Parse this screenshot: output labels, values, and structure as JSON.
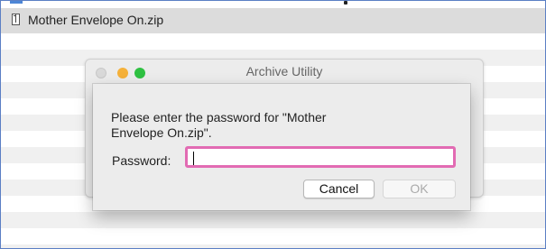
{
  "file_list": {
    "file_name": "Mother Envelope On.zip",
    "file_icon": "zip-file-icon"
  },
  "background_window": {
    "title": "Archive Utility",
    "buttons": [
      "close-button",
      "minimize-button",
      "zoom-button"
    ]
  },
  "dialog": {
    "message": "Please enter the password for \"Mother Envelope On.zip\".",
    "password_label": "Password:",
    "password_value": "",
    "cancel_label": "Cancel",
    "ok_label": "OK"
  },
  "colors": {
    "input_focus_ring": "#e26bb3",
    "minimize": "#f5b13a",
    "zoom": "#2fc142"
  }
}
